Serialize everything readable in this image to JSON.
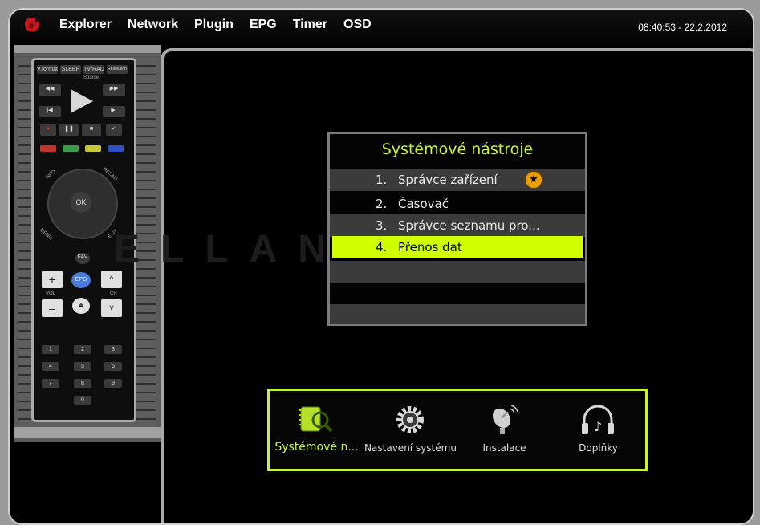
{
  "header": {
    "nav": [
      "Explorer",
      "Network",
      "Plugin",
      "EPG",
      "Timer",
      "OSD"
    ],
    "datetime": "08:40:53 - 22.2.2012"
  },
  "menu": {
    "title": "Systémové nástroje",
    "items": [
      {
        "num": "1.",
        "label": "Správce zařízení"
      },
      {
        "num": "2.",
        "label": "Časovač"
      },
      {
        "num": "3.",
        "label": "Správce seznamu pro..."
      },
      {
        "num": "4.",
        "label": "Přenos dat"
      }
    ],
    "selected_index": 3
  },
  "bottom_menu": {
    "items": [
      {
        "label": "Systémové n...",
        "icon": "system-tools-icon"
      },
      {
        "label": "Nastavení systému",
        "icon": "gear-icon"
      },
      {
        "label": "Instalace",
        "icon": "satellite-dish-icon"
      },
      {
        "label": "Doplňky",
        "icon": "headphones-icon"
      }
    ]
  },
  "remote": {
    "top_buttons": [
      "V.format",
      "SLEEP",
      "TV/RAD",
      "Resolution"
    ],
    "source_label": "Source",
    "ok": "OK",
    "info": "INFO",
    "recall": "RECALL",
    "menu_label": "MENU",
    "exit": "EXIT",
    "fav": "FAV",
    "epg": "EPG",
    "vol": "VOL",
    "ch": "CH",
    "digits": [
      "1",
      "2",
      "3",
      "4",
      "5",
      "6",
      "7",
      "8",
      "9",
      "0"
    ]
  },
  "watermark": "ELLANO.SK",
  "colors": {
    "accent": "#c8f53a",
    "selected_row": "#d0ff00",
    "remote_red": "#c0342c",
    "remote_green": "#3a9a4a",
    "remote_yellow": "#c8c83a",
    "remote_blue": "#3050c0"
  }
}
